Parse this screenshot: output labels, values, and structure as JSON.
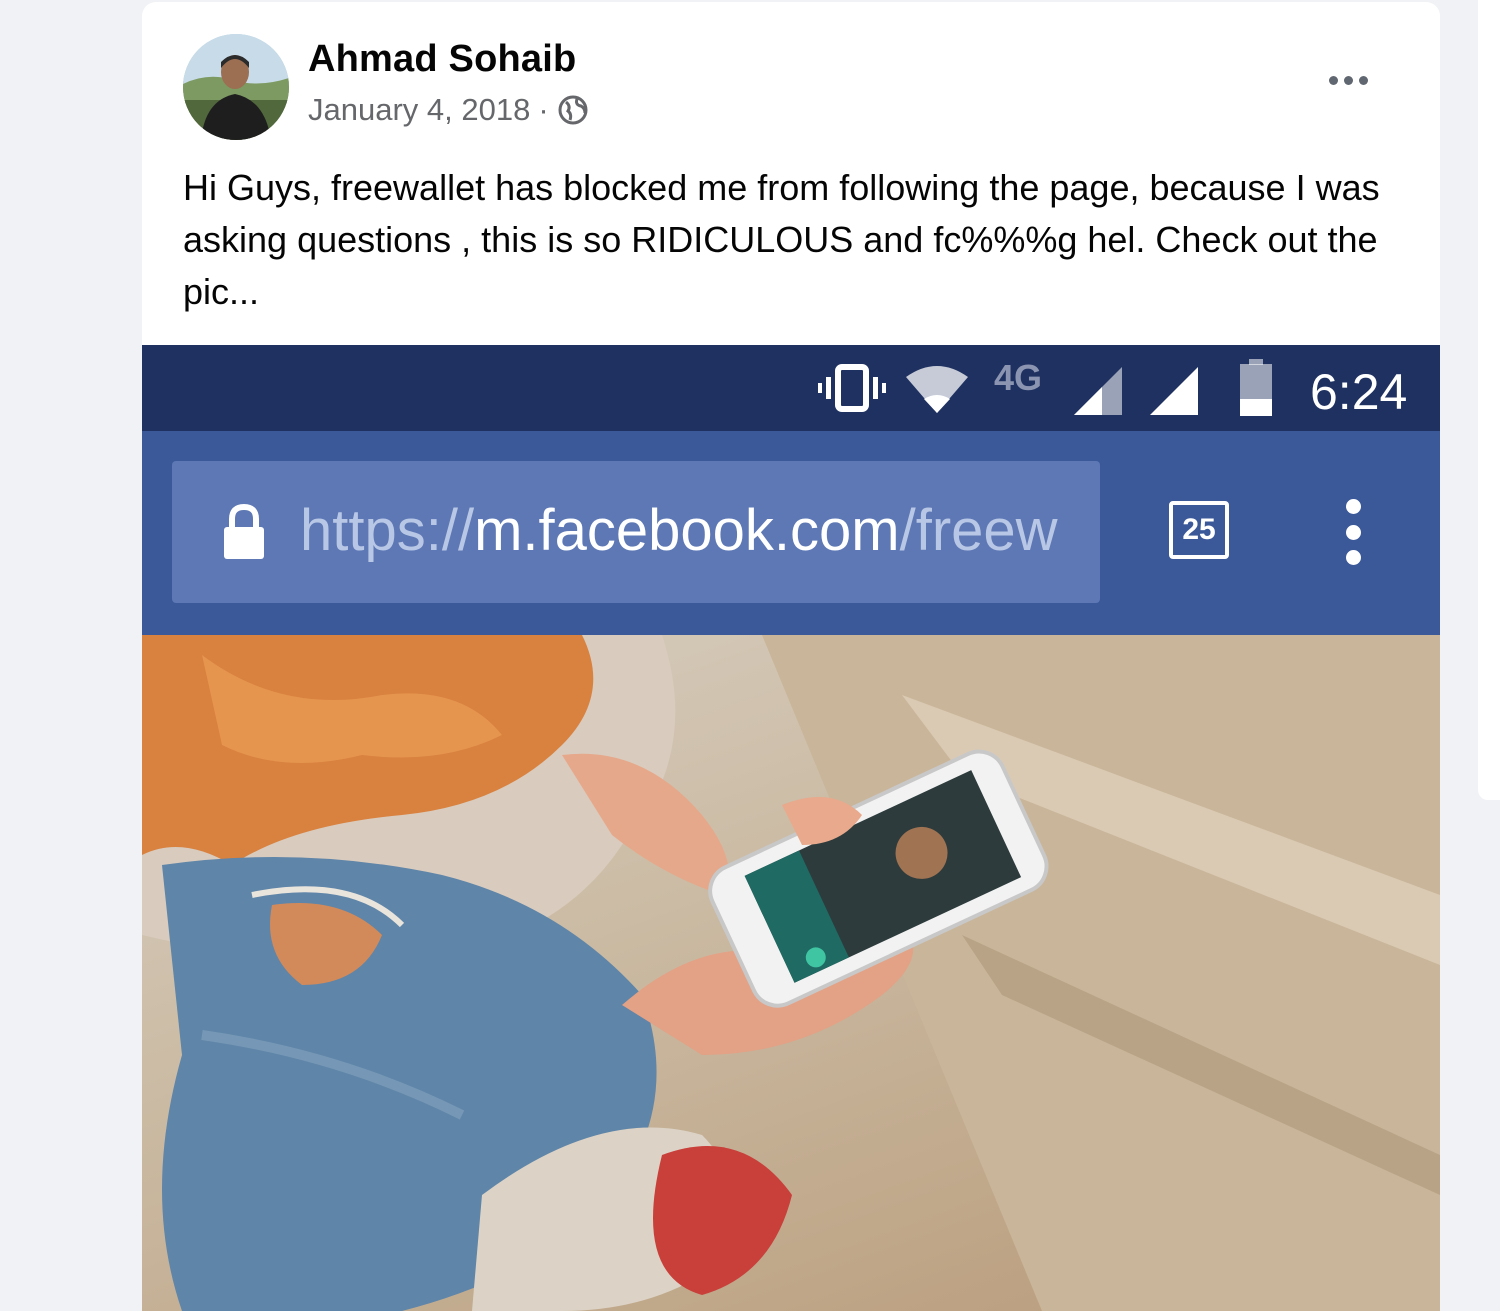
{
  "post": {
    "author": "Ahmad Sohaib",
    "date": "January 4, 2018",
    "separator": "·",
    "privacy_icon": "globe-icon",
    "more_icon": "more-options-icon",
    "text": "Hi Guys, freewallet has blocked me from following the page, because I was asking questions , this is so RIDICULOUS and fc%%%g hel. Check out the pic..."
  },
  "screenshot": {
    "statusbar": {
      "network": "4G",
      "time": "6:24",
      "icons": [
        "vibrate-icon",
        "wifi-icon",
        "signal-icon",
        "signal-icon",
        "battery-icon"
      ]
    },
    "browser": {
      "url_scheme": "https://",
      "url_host": "m.facebook.com",
      "url_path": "/freew",
      "tab_count": "25",
      "lock_icon": "lock-icon",
      "menu_icon": "kebab-menu-icon"
    },
    "photo_description_icon": "photo"
  },
  "colors": {
    "status_bar": "#1f3161",
    "browser_bar": "#3b5998",
    "url_box": "#5d78b4",
    "meta_text": "#65676b"
  }
}
